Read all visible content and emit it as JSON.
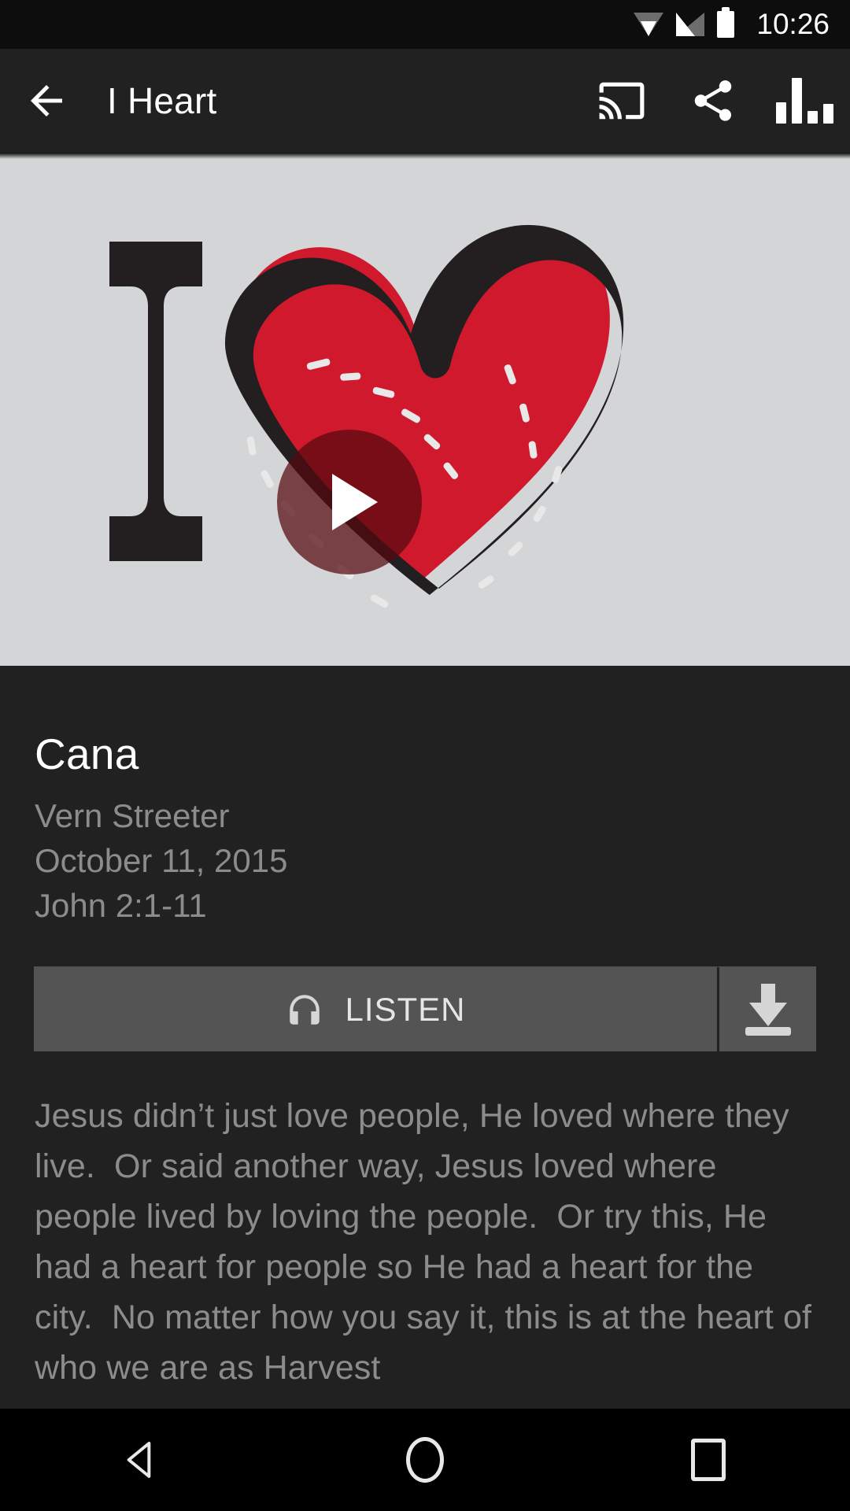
{
  "status_bar": {
    "time": "10:26",
    "icons": [
      "wifi-icon",
      "signal-icon",
      "battery-icon"
    ]
  },
  "toolbar": {
    "back_icon": "back-arrow-icon",
    "title": "I Heart",
    "actions": [
      {
        "name": "cast-icon",
        "label": "Cast"
      },
      {
        "name": "share-icon",
        "label": "Share"
      },
      {
        "name": "bar-chart-icon",
        "label": "Stats"
      }
    ]
  },
  "hero": {
    "alt_text": "I Heart",
    "logo_letter": "I",
    "play_icon": "play-icon",
    "background_color": "#d3d5d7",
    "heart_color": "#d1192e",
    "outline_color": "#221f1f"
  },
  "details": {
    "title": "Cana",
    "speaker": "Vern Streeter",
    "date": "October 11, 2015",
    "scripture": "John 2:1-11",
    "listen_label": "LISTEN",
    "listen_icon": "headphones-icon",
    "download_icon": "download-icon",
    "description": "Jesus didn’t just love people, He loved where they live.  Or said another way, Jesus loved where people lived by loving the people.  Or try this, He had a heart for people so He had a heart for the city.  No matter how you say it, this is at the heart of who we are as Harvest"
  },
  "nav_bar": {
    "back": "nav-back-icon",
    "home": "nav-home-icon",
    "recents": "nav-recents-icon"
  }
}
